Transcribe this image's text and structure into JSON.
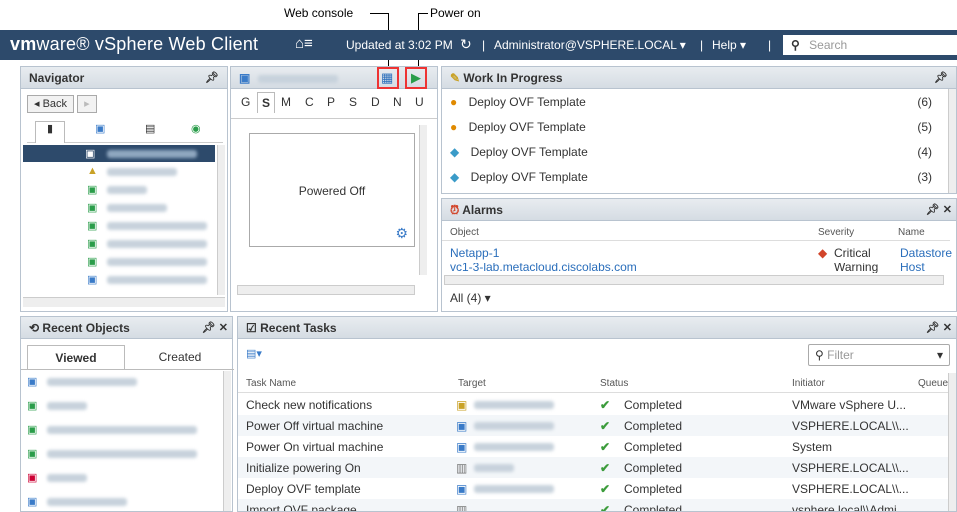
{
  "callouts": {
    "web_console": "Web console",
    "power_on": "Power on"
  },
  "topbar": {
    "brand_vm": "vm",
    "brand_ware": "ware®",
    "product": " vSphere Web Client",
    "home_glyph": "⌂≡",
    "updated": "Updated at 3:02 PM",
    "refresh_glyph": "↻",
    "user": "Administrator@VSPHERE.LOCAL ▾",
    "help": "Help ▾",
    "search_placeholder": "Search",
    "sep": "|"
  },
  "navigator": {
    "title": "Navigator",
    "back": "◂ Back",
    "forward": "▸"
  },
  "vm_summary": {
    "tabs": [
      "G",
      "S",
      "M",
      "C",
      "P",
      "S",
      "D",
      "N",
      "U"
    ],
    "active_tab_index": 1,
    "status": "Powered Off"
  },
  "wip": {
    "title": "Work In Progress",
    "items": [
      {
        "label": "Deploy OVF Template",
        "count": "(6)",
        "icon": "warning-icon"
      },
      {
        "label": "Deploy OVF Template",
        "count": "(5)",
        "icon": "warning-icon"
      },
      {
        "label": "Deploy OVF Template",
        "count": "(4)",
        "icon": "vm-deploy-icon"
      },
      {
        "label": "Deploy OVF Template",
        "count": "(3)",
        "icon": "vm-deploy-icon"
      }
    ]
  },
  "alarms": {
    "title": "Alarms",
    "headers": {
      "object": "Object",
      "severity": "Severity",
      "name": "Name"
    },
    "rows": [
      {
        "object": "Netapp-1",
        "severity": "Critical",
        "name": "Datastore"
      },
      {
        "object": "vc1-3-lab.metacloud.ciscolabs.com",
        "severity": "Warning",
        "name": "Host mem"
      }
    ],
    "filter": "All (4) ▾"
  },
  "recent_objects": {
    "title": "Recent Objects",
    "tab_viewed": "Viewed",
    "tab_created": "Created"
  },
  "recent_tasks": {
    "title": "Recent Tasks",
    "filter_placeholder": "Filter",
    "headers": {
      "task": "Task Name",
      "target": "Target",
      "status": "Status",
      "initiator": "Initiator",
      "queued": "Queued"
    },
    "rows": [
      {
        "task": "Check new notifications",
        "status": "Completed",
        "initiator": "VMware vSphere U..."
      },
      {
        "task": "Power Off virtual machine",
        "status": "Completed",
        "initiator": "VSPHERE.LOCAL\\\\..."
      },
      {
        "task": "Power On virtual machine",
        "status": "Completed",
        "initiator": "System"
      },
      {
        "task": "Initialize powering On",
        "status": "Completed",
        "initiator": "VSPHERE.LOCAL\\\\..."
      },
      {
        "task": "Deploy OVF template",
        "status": "Completed",
        "initiator": "VSPHERE.LOCAL\\\\..."
      },
      {
        "task": "Import OVF package",
        "status": "Completed",
        "initiator": "vsphere.local\\\\Admi..."
      }
    ]
  },
  "colors": {
    "topbar": "#2d4a6b",
    "highlight": "#e33333",
    "link": "#2a6ebb"
  }
}
